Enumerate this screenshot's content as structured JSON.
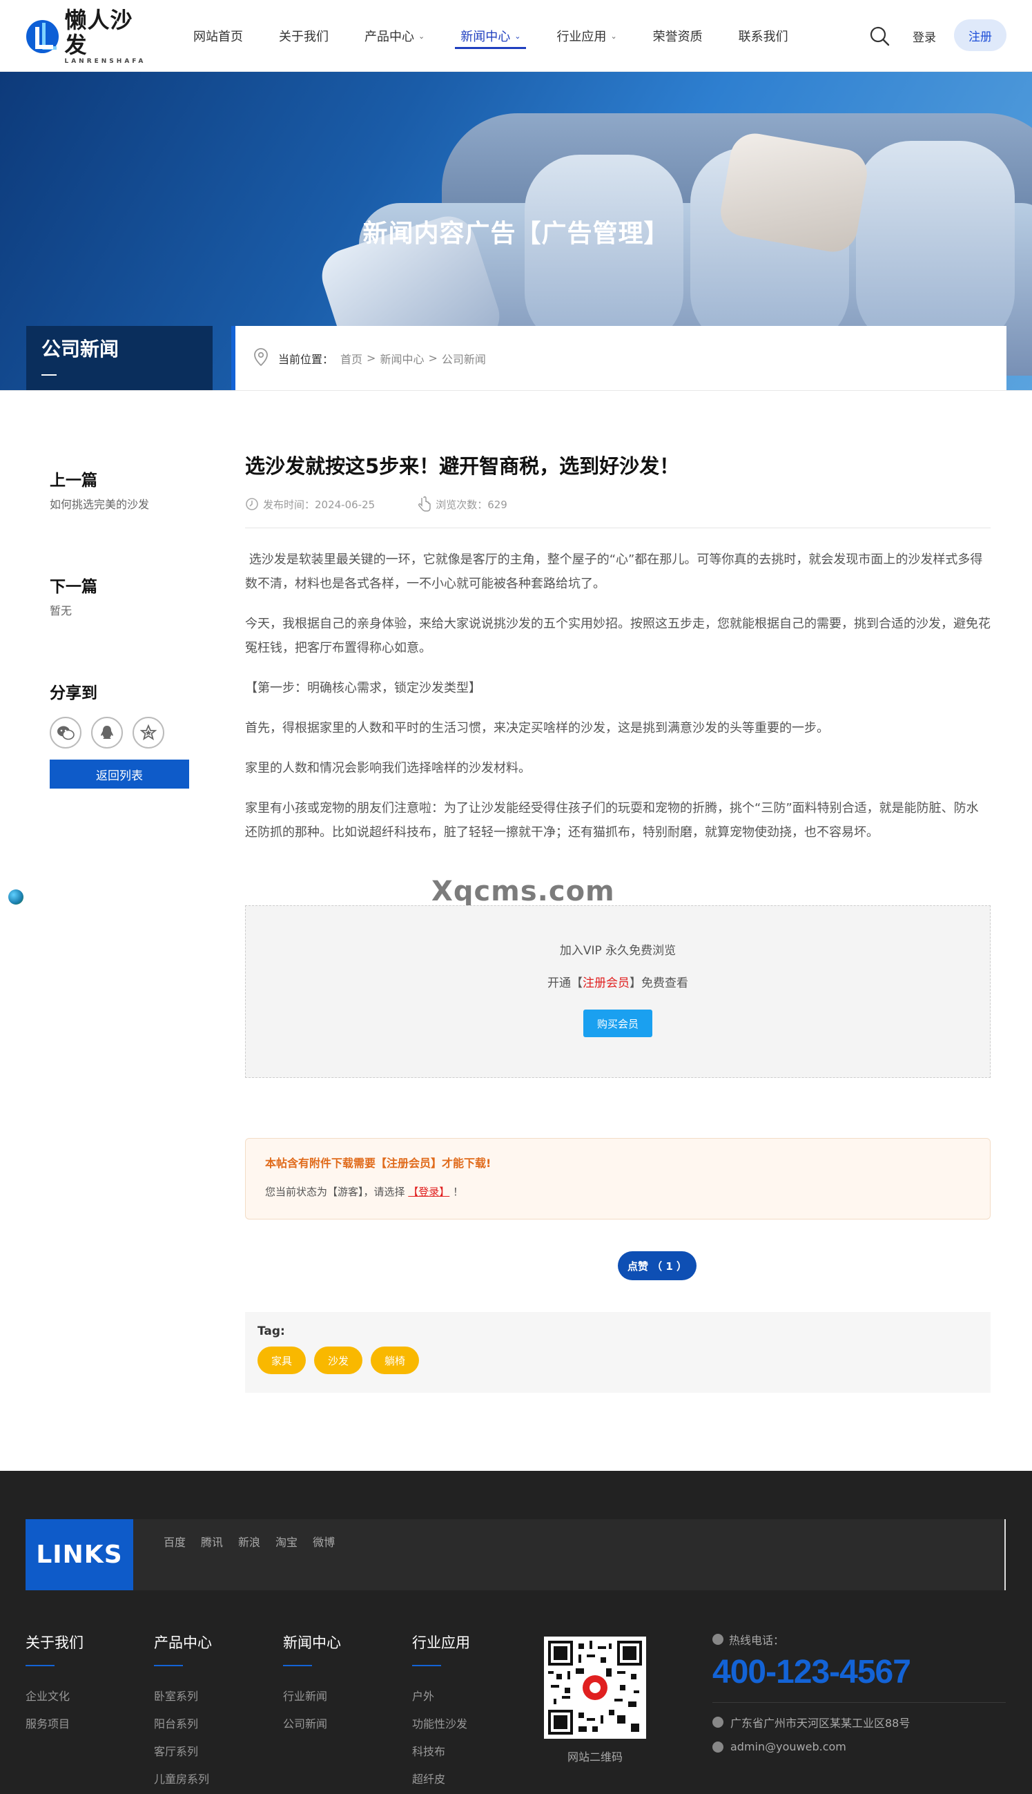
{
  "header": {
    "logo_cn": "懒人沙发",
    "logo_en": "LANRENSHAFA",
    "nav": [
      {
        "label": "网站首页",
        "dropdown": false,
        "active": false
      },
      {
        "label": "关于我们",
        "dropdown": false,
        "active": false
      },
      {
        "label": "产品中心",
        "dropdown": true,
        "active": false
      },
      {
        "label": "新闻中心",
        "dropdown": true,
        "active": true
      },
      {
        "label": "行业应用",
        "dropdown": true,
        "active": false
      },
      {
        "label": "荣誉资质",
        "dropdown": false,
        "active": false
      },
      {
        "label": "联系我们",
        "dropdown": false,
        "active": false
      }
    ],
    "login": "登录",
    "register": "注册"
  },
  "banner": {
    "title": "新闻内容广告【广告管理】",
    "section": "公司新闻",
    "crumb_label": "当前位置：",
    "crumbs": [
      "首页",
      "新闻中心",
      "公司新闻"
    ],
    "crumb_sep": ">"
  },
  "sidebar": {
    "prev_heading": "上一篇",
    "prev_title": "如何挑选完美的沙发",
    "next_heading": "下一篇",
    "next_title": "暂无",
    "share_heading": "分享到",
    "back_label": "返回列表"
  },
  "article": {
    "title": "选沙发就按这5步来！避开智商税，选到好沙发！",
    "publish": "发布时间：2024-06-25",
    "views": "浏览次数：629",
    "paragraphs": [
      " 选沙发是软装里最关键的一环，它就像是客厅的主角，整个屋子的“心”都在那儿。可等你真的去挑时，就会发现市面上的沙发样式多得数不清，材料也是各式各样，一不小心就可能被各种套路给坑了。",
      "今天，我根据自己的亲身体验，来给大家说说挑沙发的五个实用妙招。按照这五步走，您就能根据自己的需要，挑到合适的沙发，避免花冤枉钱，把客厅布置得称心如意。",
      "【第一步：明确核心需求，锁定沙发类型】",
      "首先，得根据家里的人数和平时的生活习惯，来决定买啥样的沙发，这是挑到满意沙发的头等重要的一步。",
      "家里的人数和情况会影响我们选择啥样的沙发材料。",
      "家里有小孩或宠物的朋友们注意啦：为了让沙发能经受得住孩子们的玩耍和宠物的折腾，挑个“三防”面料特别合适，就是能防脏、防水还防抓的那种。比如说超纤科技布，脏了轻轻一擦就干净；还有猫抓布，特别耐磨，就算宠物使劲挠，也不容易坏。"
    ]
  },
  "watermark": "Xqcms.com",
  "vip": {
    "line1": "加入VIP 永久免费浏览",
    "line2_pre": "开通【",
    "line2_link": "注册会员",
    "line2_post": "】免费查看",
    "buy": "购买会员"
  },
  "attachment": {
    "title": "本帖含有附件下载需要【注册会员】才能下载!",
    "text_pre": "您当前状态为【游客】，请选择 ",
    "login_link": "【登录】",
    "text_post": " ！"
  },
  "like": {
    "label": "点赞 （ 1 ）"
  },
  "tags": {
    "label": "Tag:",
    "items": [
      "家具",
      "沙发",
      "躺椅"
    ]
  },
  "footer": {
    "links_badge": "LINKS",
    "links": [
      "百度",
      "腾讯",
      "新浪",
      "淘宝",
      "微博"
    ],
    "columns": [
      {
        "heading": "关于我们",
        "items": [
          "企业文化",
          "服务项目"
        ]
      },
      {
        "heading": "产品中心",
        "items": [
          "卧室系列",
          "阳台系列",
          "客厅系列",
          "儿童房系列"
        ]
      },
      {
        "heading": "新闻中心",
        "items": [
          "行业新闻",
          "公司新闻"
        ]
      },
      {
        "heading": "行业应用",
        "items": [
          "户外",
          "功能性沙发",
          "科技布",
          "超纤皮"
        ]
      }
    ],
    "qr_caption": "网站二维码",
    "hotline_label": "热线电话：",
    "hotline": "400-123-4567",
    "address": "广东省广州市天河区某某工业区88号",
    "email": "admin@youweb.com"
  },
  "colors": {
    "brand": "#0e5bc9",
    "nav_active": "#1f3fbf",
    "tag": "#f9b800",
    "footer_bg": "#222222"
  }
}
